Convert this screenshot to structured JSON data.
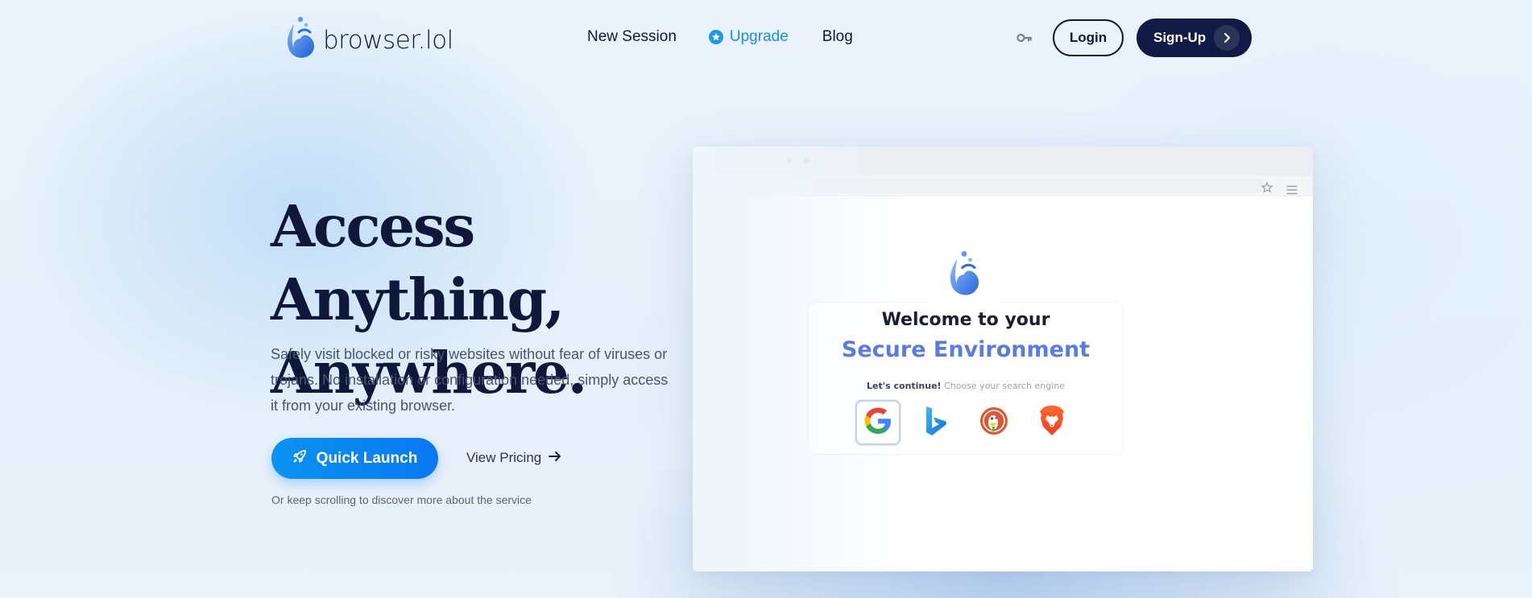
{
  "brand": {
    "name": "browser.lol"
  },
  "nav": {
    "new_session": "New Session",
    "upgrade": "Upgrade",
    "blog": "Blog",
    "login": "Login",
    "signup": "Sign-Up"
  },
  "hero": {
    "title_line1": "Access Anything,",
    "title_line2": "Anywhere.",
    "description": "Safely visit blocked or risky websites without fear of viruses or trojans. No installation or configuration needed, simply access it from your existing browser.",
    "cta_primary": "Quick Launch",
    "cta_secondary": "View Pricing",
    "note": "Or keep scrolling to discover more about the service"
  },
  "mockup": {
    "welcome": "Welcome to your",
    "secure": "Secure Environment",
    "continue_bold": "Let's continue!",
    "continue_rest": " Choose your search engine",
    "engines": [
      {
        "name": "google-icon",
        "letter": "G",
        "color": "#4285F4"
      },
      {
        "name": "bing-icon",
        "letter": "b",
        "color": "#1f8fe0"
      },
      {
        "name": "duckduckgo-icon",
        "letter": "D",
        "color": "#de5833"
      },
      {
        "name": "brave-icon",
        "letter": "B",
        "color": "#fb542b"
      }
    ]
  },
  "colors": {
    "primary": "#0a85f0",
    "navy": "#111a44",
    "accent_link": "#1a8ee8",
    "secure_text": "#5b7ae2"
  }
}
